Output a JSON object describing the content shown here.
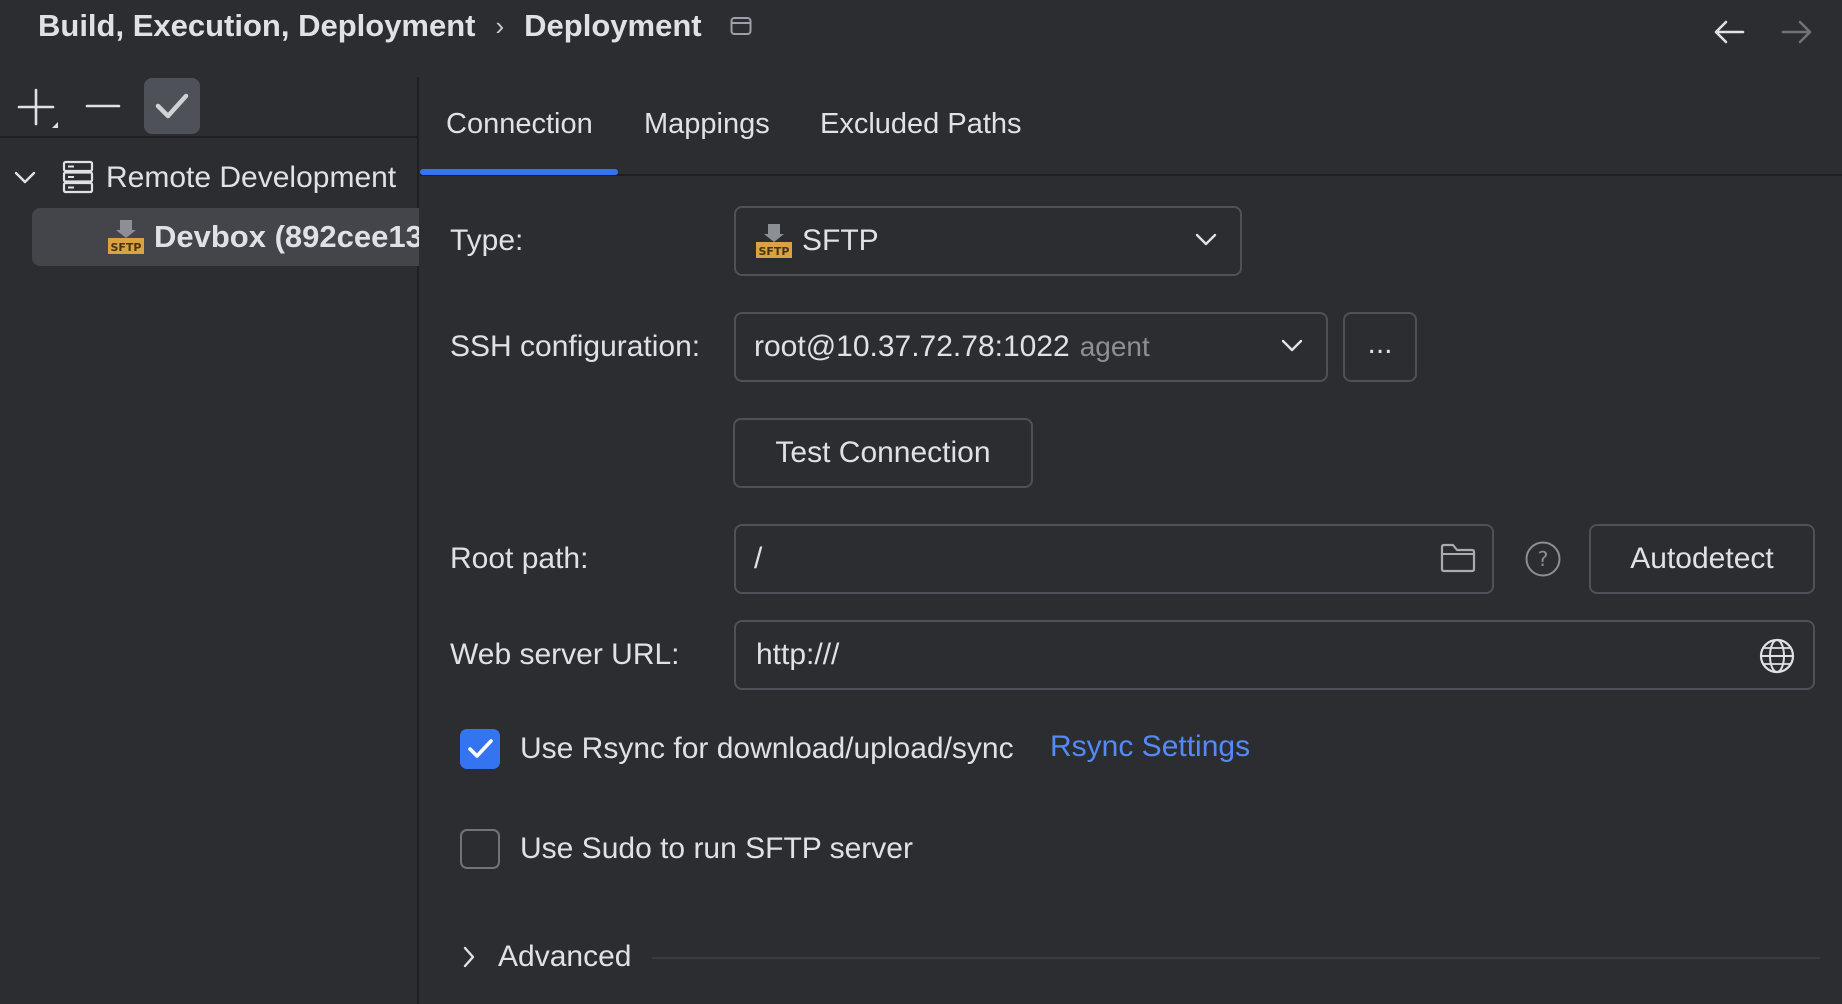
{
  "breadcrumb": {
    "parent": "Build, Execution, Deployment",
    "separator": "›",
    "current": "Deployment"
  },
  "icons": {
    "window": "window-icon",
    "back": "arrow-left-icon",
    "forward": "arrow-right-icon",
    "add": "plus-icon",
    "remove": "minus-icon",
    "default": "checkmark-icon",
    "server": "server-icon",
    "sftp": "sftp-icon",
    "folder": "folder-icon",
    "help": "help-icon",
    "globe": "globe-icon"
  },
  "tree": {
    "root_label": "Remote Development",
    "child_label": "Devbox (892cee13"
  },
  "tabs": [
    {
      "label": "Connection",
      "selected": true
    },
    {
      "label": "Mappings",
      "selected": false
    },
    {
      "label": "Excluded Paths",
      "selected": false
    }
  ],
  "form": {
    "type_label": "Type:",
    "type_value": "SFTP",
    "ssh_label": "SSH configuration:",
    "ssh_value": "root@10.37.72.78:1022",
    "ssh_hint": "agent",
    "ssh_more": "...",
    "test_button": "Test Connection",
    "root_label": "Root path:",
    "root_value": "/",
    "autodetect_button": "Autodetect",
    "url_label": "Web server URL:",
    "url_value": "http:///",
    "rsync_label": "Use Rsync for download/upload/sync",
    "rsync_checked": true,
    "rsync_link": "Rsync Settings",
    "sudo_label": "Use Sudo to run SFTP server",
    "sudo_checked": false,
    "advanced_label": "Advanced"
  },
  "colors": {
    "background": "#2b2d30",
    "accent": "#3574f0",
    "link": "#548af7",
    "selection": "#43454a",
    "text": "#dfe1e5"
  }
}
